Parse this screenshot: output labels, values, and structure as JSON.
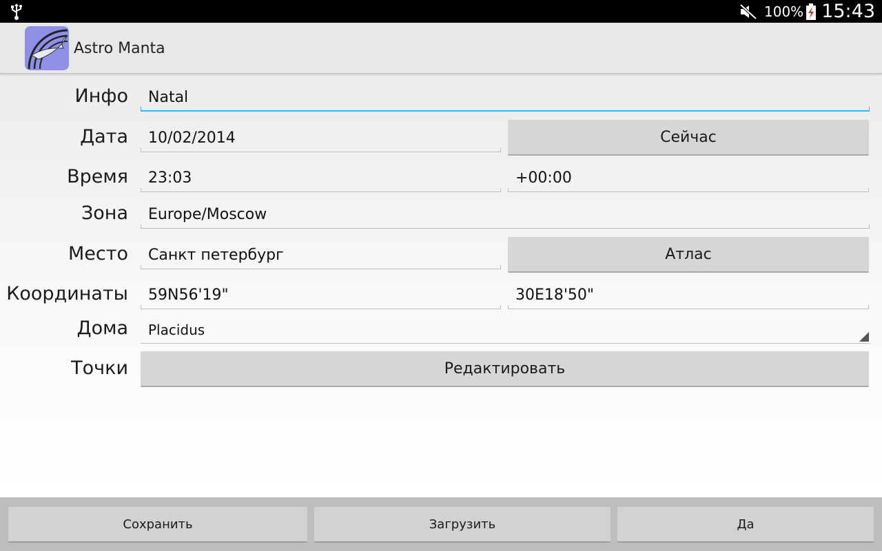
{
  "status_bar": {
    "battery_percent": "100%",
    "time": "15:43",
    "icons": [
      "usb-icon",
      "mute-icon",
      "battery-charging-icon"
    ]
  },
  "action_bar": {
    "app_title": "Astro Manta",
    "icon": "astro-manta-app-icon"
  },
  "form": {
    "info": {
      "label": "Инфо",
      "value": "Natal"
    },
    "date": {
      "label": "Дата",
      "value": "10/02/2014",
      "button": "Сейчас"
    },
    "time": {
      "label": "Время",
      "value": "23:03",
      "offset": "+00:00"
    },
    "zone": {
      "label": "Зона",
      "value": "Europe/Moscow"
    },
    "place": {
      "label": "Место",
      "value": "Санкт петербург",
      "button": "Атлас"
    },
    "coords": {
      "label": "Координаты",
      "latitude": "59N56'19\"",
      "longitude": "30E18'50\""
    },
    "houses": {
      "label": "Дома",
      "selected": "Placidus"
    },
    "points": {
      "label": "Точки",
      "button": "Редактировать"
    }
  },
  "bottom_bar": {
    "save": "Сохранить",
    "load": "Загрузить",
    "ok": "Да"
  },
  "colors": {
    "accent": "#33b5e5",
    "status_bar": "#000000",
    "action_bar": "#e8e8e8",
    "app_icon_bg": "#8f8fe6"
  }
}
